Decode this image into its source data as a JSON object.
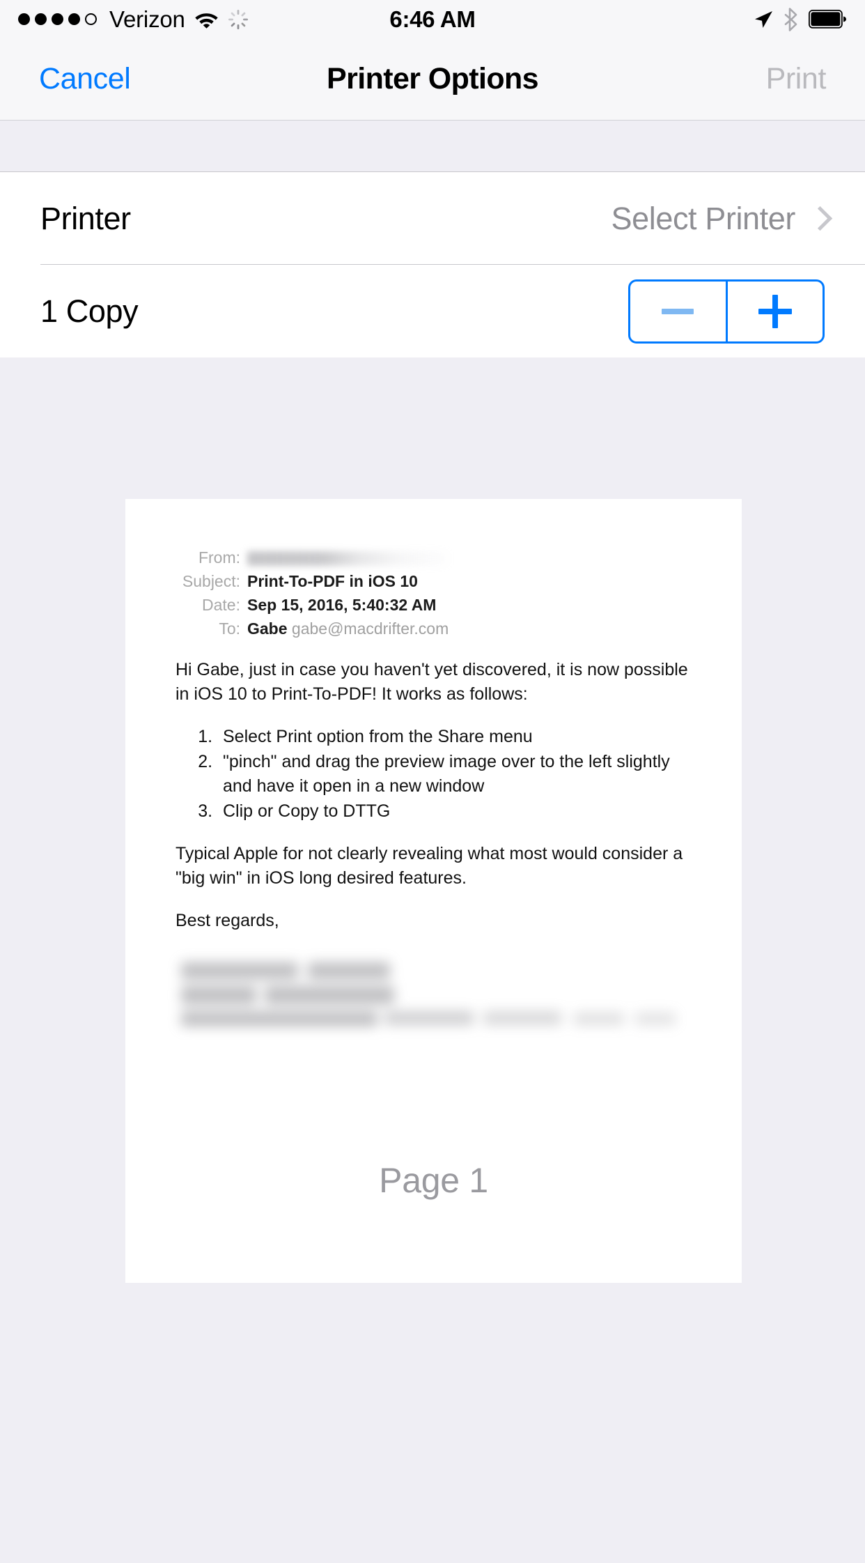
{
  "status_bar": {
    "carrier": "Verizon",
    "time": "6:46 AM",
    "signal_bars_filled": 4,
    "signal_bars_total": 5,
    "icons": [
      "wifi-icon",
      "activity-spinner-icon",
      "location-arrow-icon",
      "bluetooth-icon",
      "battery-full-icon"
    ]
  },
  "nav_bar": {
    "cancel_label": "Cancel",
    "title": "Printer Options",
    "print_label": "Print"
  },
  "options": {
    "printer": {
      "label": "Printer",
      "value": "Select Printer"
    },
    "copies": {
      "label": "1 Copy",
      "decrement_label": "−",
      "increment_label": "+"
    }
  },
  "preview": {
    "page_label": "Page 1",
    "mail": {
      "headers": [
        {
          "label": "From:",
          "value": "",
          "redacted": true
        },
        {
          "label": "Subject:",
          "value": "Print-To-PDF in iOS 10",
          "redacted": false
        },
        {
          "label": "Date:",
          "value": "Sep 15, 2016, 5:40:32 AM",
          "redacted": false
        },
        {
          "label": "To:",
          "value": "Gabe",
          "secondary": "gabe@macdrifter.com",
          "redacted": false
        }
      ],
      "intro": "Hi Gabe, just in case you haven't yet discovered, it is now possible in iOS 10 to Print-To-PDF! It works as follows:",
      "steps": [
        "Select Print option from the Share menu",
        "\"pinch\" and drag the preview image over to the left slightly and have it open in a new window",
        "Clip or Copy to DTTG"
      ],
      "closing": "Typical Apple for not clearly revealing what most would consider a \"big win\" in iOS long desired features.",
      "signoff": "Best regards,",
      "signature_redacted": true
    }
  },
  "colors": {
    "accent_blue": "#007AFF",
    "disabled_blue": "#7FB8F2",
    "disabled_gray": "#B9B9BD",
    "value_gray": "#8E8E93",
    "background": "#EFEEF4",
    "bar_background": "#F7F7F9"
  }
}
